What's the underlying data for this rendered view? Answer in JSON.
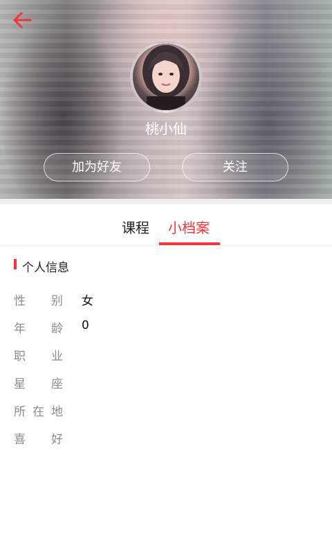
{
  "header": {
    "username": "桃小仙",
    "add_friend_label": "加为好友",
    "follow_label": "关注"
  },
  "tabs": [
    {
      "label": "课程",
      "active": false
    },
    {
      "label": "小档案",
      "active": true
    }
  ],
  "section": {
    "title": "个人信息"
  },
  "info": [
    {
      "label_chars": [
        "性",
        "别"
      ],
      "value": "女"
    },
    {
      "label_chars": [
        "年",
        "龄"
      ],
      "value": "0"
    },
    {
      "label_chars": [
        "职",
        "业"
      ],
      "value": ""
    },
    {
      "label_chars": [
        "星",
        "座"
      ],
      "value": ""
    },
    {
      "label_chars": [
        "所",
        "在",
        "地"
      ],
      "value": ""
    },
    {
      "label_chars": [
        "喜",
        "好"
      ],
      "value": ""
    }
  ],
  "colors": {
    "accent": "#f2353a",
    "label": "#8c8c8c"
  },
  "icons": {
    "back": "arrow-left-icon"
  }
}
